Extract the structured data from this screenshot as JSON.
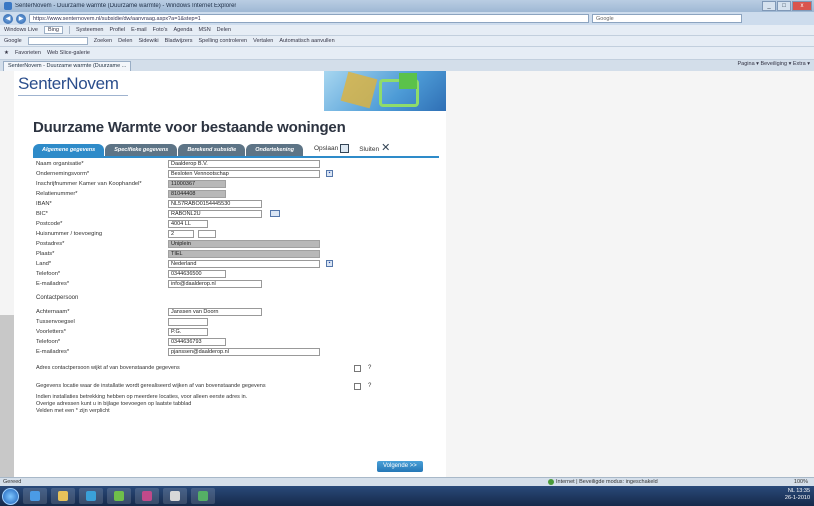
{
  "window": {
    "title": "SenterNovem - Duurzame warmte (Duurzame warmte) - Windows Internet Explorer",
    "controls": [
      "_",
      "□",
      "x"
    ]
  },
  "address": {
    "url": "https://www.senternovem.nl/subsidie/dw/aanvraag.aspx?a=1&step=1",
    "search_placeholder": "Google"
  },
  "toolbars": {
    "row1": [
      "Windows Live",
      "Bing",
      "Systeemen",
      "Profiel",
      "E-mail",
      "Foto's",
      "Agenda",
      "MSN",
      "Delen"
    ],
    "row2": [
      "Google",
      "Zoeken",
      "Delen",
      "Sidewiki",
      "Bladwijzers",
      "Spelling controleren",
      "Vertalen",
      "Automatisch aanvullen"
    ],
    "row3": [
      "Favorieten",
      "Web Slice-galerie"
    ]
  },
  "browser_tab": {
    "label": "SenterNovem - Duurzame warmte (Duurzame ..."
  },
  "command_bar": "Pagina ▾  Beveiliging ▾  Extra ▾",
  "page": {
    "logo": "SenterNovem",
    "title": "Duurzame Warmte voor bestaande woningen",
    "tabs": [
      {
        "label": "Algemene gegevens",
        "active": true
      },
      {
        "label": "Specifieke gegevens",
        "active": false
      },
      {
        "label": "Berekend subsidie",
        "active": false
      },
      {
        "label": "Ondertekening",
        "active": false
      }
    ],
    "opslaan": "Opslaan",
    "sluiten": "Sluiten",
    "fields": [
      {
        "label": "Naam organisatie*",
        "value": "Daalderop B.V."
      },
      {
        "label": "Ondernemingsvorm*",
        "value": "Besloten Vennootschap"
      },
      {
        "label": "Inschrijfnummer Kamer van Koophandel*",
        "value": "11000367",
        "readonly": true
      },
      {
        "label": "Relatienummer*",
        "value": "81044408",
        "readonly": true
      },
      {
        "label": "IBAN*",
        "value": "NL57RABO0154445530"
      },
      {
        "label": "BIC*",
        "value": "RABONL2U"
      },
      {
        "label": "Postcode*",
        "value": "4004 LL"
      },
      {
        "label": "Huisnummer / toevoeging",
        "value": "2",
        "suffix": ""
      },
      {
        "label": "Postadres*",
        "value": "Uniplein",
        "readonly": true
      },
      {
        "label": "Plaats*",
        "value": "TIEL",
        "readonly": true
      },
      {
        "label": "Land*",
        "value": "Nederland"
      },
      {
        "label": "Telefoon*",
        "value": "0344636500"
      },
      {
        "label": "E-mailadres*",
        "value": "info@daalderop.nl"
      }
    ],
    "contact_section": "Contactpersoon",
    "contact_fields": [
      {
        "label": "Achternaam*",
        "value": "Janssen van Doorn"
      },
      {
        "label": "Tussenvoegsel",
        "value": ""
      },
      {
        "label": "Voorletters*",
        "value": "P.G."
      },
      {
        "label": "Telefoon*",
        "value": "0344636793"
      },
      {
        "label": "E-mailadres*",
        "value": "pjanssen@daalderop.nl"
      }
    ],
    "check1": "Adres contactpersoon wijkt af van bovenstaande gegevens",
    "check2": "Gegevens locatie waar de installatie wordt gerealiseerd wijken af van bovenstaande gegevens",
    "notes": [
      "Indien installaties betrekking hebben op meerdere locaties, voor alleen eerste adres in.",
      "Overige adressen kunt u in bijlage toevoegen op laatste tabblad",
      "Velden met een * zijn verplicht"
    ],
    "question": "?",
    "next_button": "Volgende >>"
  },
  "status": {
    "left": "Gereed",
    "zone": "Internet | Beveiligde modus: ingeschakeld",
    "zoom": "100%"
  },
  "tray": {
    "lang": "NL",
    "time": "13:35",
    "date": "26-1-2010"
  }
}
